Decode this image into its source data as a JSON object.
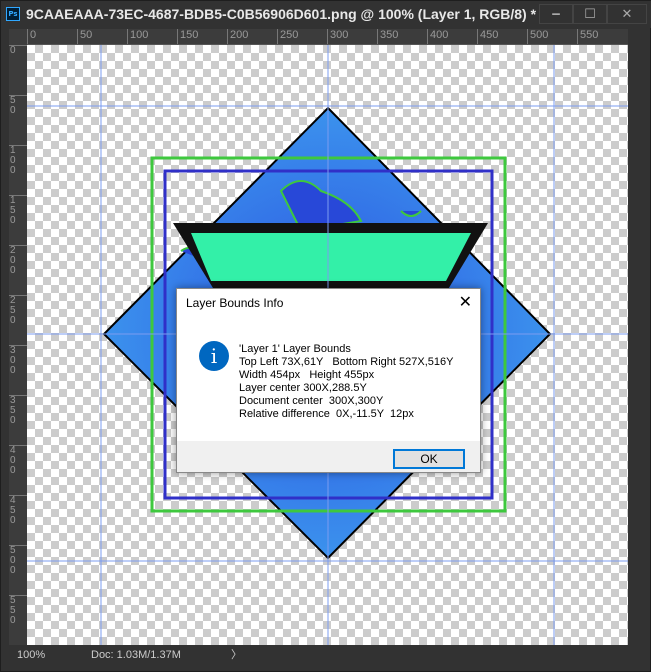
{
  "window": {
    "title": "9CAAEAAA-73EC-4687-BDB5-C0B56906D601.png @ 100% (Layer 1, RGB/8) *",
    "app_icon": "Ps",
    "minimize": "‒",
    "maximize": "☐",
    "close": "✕"
  },
  "ruler": {
    "h": [
      "0",
      "50",
      "100",
      "150",
      "200",
      "250",
      "300",
      "350",
      "400",
      "450",
      "500",
      "550"
    ],
    "v": [
      "0",
      "5\n0",
      "1\n0\n0",
      "1\n5\n0",
      "2\n0\n0",
      "2\n5\n0",
      "3\n0\n0",
      "3\n5\n0",
      "4\n0\n0",
      "4\n5\n0",
      "5\n0\n0",
      "5\n5\n0"
    ]
  },
  "status": {
    "zoom": "100%",
    "doc": "Doc: 1.03M/1.37M",
    "arrow": "〉"
  },
  "dialog": {
    "title": "Layer Bounds Info",
    "close": "✕",
    "icon": "i",
    "lines": [
      "'Layer 1' Layer Bounds",
      "Top Left 73X,61Y   Bottom Right 527X,516Y",
      "Width 454px   Height 455px",
      "Layer center 300X,288.5Y",
      "Document center  300X,300Y",
      "Relative difference  0X,-11.5Y  12px"
    ],
    "ok": "OK"
  },
  "colors": {
    "guide": "#7b9cf0",
    "green": "#3ec83e",
    "blue": "#3030c8",
    "teal": "#33f0a8",
    "diamond": "#2a6ae0"
  }
}
